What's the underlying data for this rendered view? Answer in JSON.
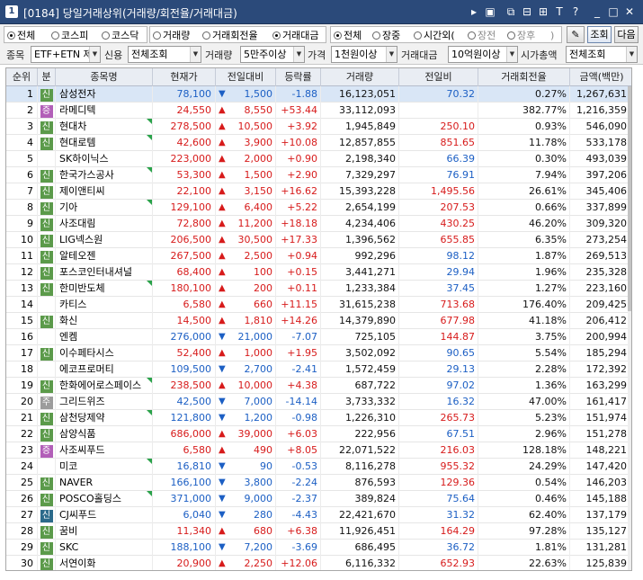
{
  "window": {
    "badge": "1",
    "title": "[0184] 당일거래상위(거래량/회전율/거래대금)"
  },
  "filters": {
    "market": [
      "전체",
      "코스피",
      "코스닥"
    ],
    "market_selected": 0,
    "sort": [
      "거래량",
      "거래회전율",
      "거래대금"
    ],
    "sort_selected": 2,
    "session": [
      "전체",
      "장중",
      "시간외("
    ],
    "session_selected": 0,
    "after_hours": [
      "장전",
      "장후",
      ")"
    ],
    "search_button": "조회",
    "next_button": "다음",
    "item_label": "종목",
    "item_value": "ETF+ETN 제",
    "credit_label": "신용",
    "credit_value": "전체조회",
    "volume_label": "거래량",
    "volume_value": "5만주이상",
    "price_label": "가격",
    "price_value": "1천원이상",
    "amount_label": "거래대금",
    "amount_value": "10억원이상",
    "cap_label": "시가총액",
    "cap_value": "전체조회"
  },
  "columns": [
    "순위",
    "분",
    "종목명",
    "현재가",
    "전일대비",
    "등락률",
    "거래량",
    "전일비",
    "거래회전율",
    "금액(백만)"
  ],
  "colors": {
    "up": "#d71b1b",
    "down": "#1c5fc4",
    "tag_credit": "#5b9a4a",
    "tag_margin": "#b25fb8",
    "tag_special": "#9c9c9c",
    "tag_dark": "#2b6a8a"
  },
  "rows": [
    {
      "rank": "1",
      "tag": "신",
      "tag_color": "#5b9a4a",
      "name": "삼성전자",
      "price": "78,100",
      "dir": "down",
      "chg": "1,500",
      "rate": "-1.88",
      "vol": "16,123,051",
      "prev": "70.32",
      "prev_color": "blue",
      "turn": "0.27%",
      "amt": "1,267,631",
      "tri": false
    },
    {
      "rank": "2",
      "tag": "증",
      "tag_color": "#b25fb8",
      "name": "라메디텍",
      "price": "24,550",
      "dir": "up",
      "chg": "8,550",
      "rate": "+53.44",
      "vol": "33,112,093",
      "prev": "",
      "prev_color": "blue",
      "turn": "382.77%",
      "amt": "1,216,359",
      "tri": false
    },
    {
      "rank": "3",
      "tag": "신",
      "tag_color": "#5b9a4a",
      "name": "현대차",
      "price": "278,500",
      "dir": "up",
      "chg": "10,500",
      "rate": "+3.92",
      "vol": "1,945,849",
      "prev": "250.10",
      "prev_color": "red",
      "turn": "0.93%",
      "amt": "546,090",
      "tri": true
    },
    {
      "rank": "4",
      "tag": "신",
      "tag_color": "#5b9a4a",
      "name": "현대로템",
      "price": "42,600",
      "dir": "up",
      "chg": "3,900",
      "rate": "+10.08",
      "vol": "12,857,855",
      "prev": "851.65",
      "prev_color": "red",
      "turn": "11.78%",
      "amt": "533,178",
      "tri": true
    },
    {
      "rank": "5",
      "tag": "",
      "tag_color": "",
      "name": "SK하이닉스",
      "price": "223,000",
      "dir": "up",
      "chg": "2,000",
      "rate": "+0.90",
      "vol": "2,198,340",
      "prev": "66.39",
      "prev_color": "blue",
      "turn": "0.30%",
      "amt": "493,039",
      "tri": false
    },
    {
      "rank": "6",
      "tag": "신",
      "tag_color": "#5b9a4a",
      "name": "한국가스공사",
      "price": "53,300",
      "dir": "up",
      "chg": "1,500",
      "rate": "+2.90",
      "vol": "7,329,297",
      "prev": "76.91",
      "prev_color": "blue",
      "turn": "7.94%",
      "amt": "397,206",
      "tri": true
    },
    {
      "rank": "7",
      "tag": "신",
      "tag_color": "#5b9a4a",
      "name": "제이앤티씨",
      "price": "22,100",
      "dir": "up",
      "chg": "3,150",
      "rate": "+16.62",
      "vol": "15,393,228",
      "prev": "1,495.56",
      "prev_color": "red",
      "turn": "26.61%",
      "amt": "345,406",
      "tri": false
    },
    {
      "rank": "8",
      "tag": "신",
      "tag_color": "#5b9a4a",
      "name": "기아",
      "price": "129,100",
      "dir": "up",
      "chg": "6,400",
      "rate": "+5.22",
      "vol": "2,654,199",
      "prev": "207.53",
      "prev_color": "red",
      "turn": "0.66%",
      "amt": "337,899",
      "tri": true
    },
    {
      "rank": "9",
      "tag": "신",
      "tag_color": "#5b9a4a",
      "name": "사조대림",
      "price": "72,800",
      "dir": "up",
      "chg": "11,200",
      "rate": "+18.18",
      "vol": "4,234,406",
      "prev": "430.25",
      "prev_color": "red",
      "turn": "46.20%",
      "amt": "309,320",
      "tri": false
    },
    {
      "rank": "10",
      "tag": "신",
      "tag_color": "#5b9a4a",
      "name": "LIG넥스원",
      "price": "206,500",
      "dir": "up",
      "chg": "30,500",
      "rate": "+17.33",
      "vol": "1,396,562",
      "prev": "655.85",
      "prev_color": "red",
      "turn": "6.35%",
      "amt": "273,254",
      "tri": false
    },
    {
      "rank": "11",
      "tag": "신",
      "tag_color": "#5b9a4a",
      "name": "알테오젠",
      "price": "267,500",
      "dir": "up",
      "chg": "2,500",
      "rate": "+0.94",
      "vol": "992,296",
      "prev": "98.12",
      "prev_color": "blue",
      "turn": "1.87%",
      "amt": "269,513",
      "tri": false
    },
    {
      "rank": "12",
      "tag": "신",
      "tag_color": "#5b9a4a",
      "name": "포스코인터내셔널",
      "price": "68,400",
      "dir": "up",
      "chg": "100",
      "rate": "+0.15",
      "vol": "3,441,271",
      "prev": "29.94",
      "prev_color": "blue",
      "turn": "1.96%",
      "amt": "235,328",
      "tri": false
    },
    {
      "rank": "13",
      "tag": "신",
      "tag_color": "#5b9a4a",
      "name": "한미반도체",
      "price": "180,100",
      "dir": "up",
      "chg": "200",
      "rate": "+0.11",
      "vol": "1,233,384",
      "prev": "37.45",
      "prev_color": "blue",
      "turn": "1.27%",
      "amt": "223,160",
      "tri": true
    },
    {
      "rank": "14",
      "tag": "",
      "tag_color": "",
      "name": "카티스",
      "price": "6,580",
      "dir": "up",
      "chg": "660",
      "rate": "+11.15",
      "vol": "31,615,238",
      "prev": "713.68",
      "prev_color": "red",
      "turn": "176.40%",
      "amt": "209,425",
      "tri": false
    },
    {
      "rank": "15",
      "tag": "신",
      "tag_color": "#5b9a4a",
      "name": "화신",
      "price": "14,500",
      "dir": "up",
      "chg": "1,810",
      "rate": "+14.26",
      "vol": "14,379,890",
      "prev": "677.98",
      "prev_color": "red",
      "turn": "41.18%",
      "amt": "206,412",
      "tri": false
    },
    {
      "rank": "16",
      "tag": "",
      "tag_color": "",
      "name": "엔켐",
      "price": "276,000",
      "dir": "down",
      "chg": "21,000",
      "rate": "-7.07",
      "vol": "725,105",
      "prev": "144.87",
      "prev_color": "red",
      "turn": "3.75%",
      "amt": "200,994",
      "tri": false
    },
    {
      "rank": "17",
      "tag": "신",
      "tag_color": "#5b9a4a",
      "name": "이수페타시스",
      "price": "52,400",
      "dir": "up",
      "chg": "1,000",
      "rate": "+1.95",
      "vol": "3,502,092",
      "prev": "90.65",
      "prev_color": "blue",
      "turn": "5.54%",
      "amt": "185,294",
      "tri": false
    },
    {
      "rank": "18",
      "tag": "",
      "tag_color": "",
      "name": "에코프로머티",
      "price": "109,500",
      "dir": "down",
      "chg": "2,700",
      "rate": "-2.41",
      "vol": "1,572,459",
      "prev": "29.13",
      "prev_color": "blue",
      "turn": "2.28%",
      "amt": "172,392",
      "tri": false
    },
    {
      "rank": "19",
      "tag": "신",
      "tag_color": "#5b9a4a",
      "name": "한화에어로스페이스",
      "price": "238,500",
      "dir": "up",
      "chg": "10,000",
      "rate": "+4.38",
      "vol": "687,722",
      "prev": "97.02",
      "prev_color": "blue",
      "turn": "1.36%",
      "amt": "163,299",
      "tri": true
    },
    {
      "rank": "20",
      "tag": "주",
      "tag_color": "#9c9c9c",
      "name": "그리드위즈",
      "price": "42,500",
      "dir": "down",
      "chg": "7,000",
      "rate": "-14.14",
      "vol": "3,733,332",
      "prev": "16.32",
      "prev_color": "blue",
      "turn": "47.00%",
      "amt": "161,417",
      "tri": false
    },
    {
      "rank": "21",
      "tag": "신",
      "tag_color": "#5b9a4a",
      "name": "삼천당제약",
      "price": "121,800",
      "dir": "down",
      "chg": "1,200",
      "rate": "-0.98",
      "vol": "1,226,310",
      "prev": "265.73",
      "prev_color": "red",
      "turn": "5.23%",
      "amt": "151,974",
      "tri": true
    },
    {
      "rank": "22",
      "tag": "신",
      "tag_color": "#5b9a4a",
      "name": "삼양식품",
      "price": "686,000",
      "dir": "up",
      "chg": "39,000",
      "rate": "+6.03",
      "vol": "222,956",
      "prev": "67.51",
      "prev_color": "blue",
      "turn": "2.96%",
      "amt": "151,278",
      "tri": false
    },
    {
      "rank": "23",
      "tag": "증",
      "tag_color": "#b25fb8",
      "name": "사조씨푸드",
      "price": "6,580",
      "dir": "up",
      "chg": "490",
      "rate": "+8.05",
      "vol": "22,071,522",
      "prev": "216.03",
      "prev_color": "red",
      "turn": "128.18%",
      "amt": "148,221",
      "tri": false
    },
    {
      "rank": "24",
      "tag": "",
      "tag_color": "",
      "name": "미코",
      "price": "16,810",
      "dir": "down",
      "chg": "90",
      "rate": "-0.53",
      "vol": "8,116,278",
      "prev": "955.32",
      "prev_color": "red",
      "turn": "24.29%",
      "amt": "147,420",
      "tri": true
    },
    {
      "rank": "25",
      "tag": "신",
      "tag_color": "#5b9a4a",
      "name": "NAVER",
      "price": "166,100",
      "dir": "down",
      "chg": "3,800",
      "rate": "-2.24",
      "vol": "876,593",
      "prev": "129.36",
      "prev_color": "red",
      "turn": "0.54%",
      "amt": "146,203",
      "tri": false
    },
    {
      "rank": "26",
      "tag": "신",
      "tag_color": "#5b9a4a",
      "name": "POSCO홀딩스",
      "price": "371,000",
      "dir": "down",
      "chg": "9,000",
      "rate": "-2.37",
      "vol": "389,824",
      "prev": "75.64",
      "prev_color": "blue",
      "turn": "0.46%",
      "amt": "145,188",
      "tri": true
    },
    {
      "rank": "27",
      "tag": "신",
      "tag_color": "#2b6a8a",
      "name": "CJ씨푸드",
      "price": "6,040",
      "dir": "down",
      "chg": "280",
      "rate": "-4.43",
      "vol": "22,421,670",
      "prev": "31.32",
      "prev_color": "blue",
      "turn": "62.40%",
      "amt": "137,179",
      "tri": false
    },
    {
      "rank": "28",
      "tag": "신",
      "tag_color": "#5b9a4a",
      "name": "꿈비",
      "price": "11,340",
      "dir": "up",
      "chg": "680",
      "rate": "+6.38",
      "vol": "11,926,451",
      "prev": "164.29",
      "prev_color": "red",
      "turn": "97.28%",
      "amt": "135,127",
      "tri": false
    },
    {
      "rank": "29",
      "tag": "신",
      "tag_color": "#5b9a4a",
      "name": "SKC",
      "price": "188,100",
      "dir": "down",
      "chg": "7,200",
      "rate": "-3.69",
      "vol": "686,495",
      "prev": "36.72",
      "prev_color": "blue",
      "turn": "1.81%",
      "amt": "131,281",
      "tri": false
    },
    {
      "rank": "30",
      "tag": "신",
      "tag_color": "#5b9a4a",
      "name": "서연이화",
      "price": "20,900",
      "dir": "up",
      "chg": "2,250",
      "rate": "+12.06",
      "vol": "6,116,332",
      "prev": "652.93",
      "prev_color": "red",
      "turn": "22.63%",
      "amt": "125,839",
      "tri": false
    }
  ]
}
